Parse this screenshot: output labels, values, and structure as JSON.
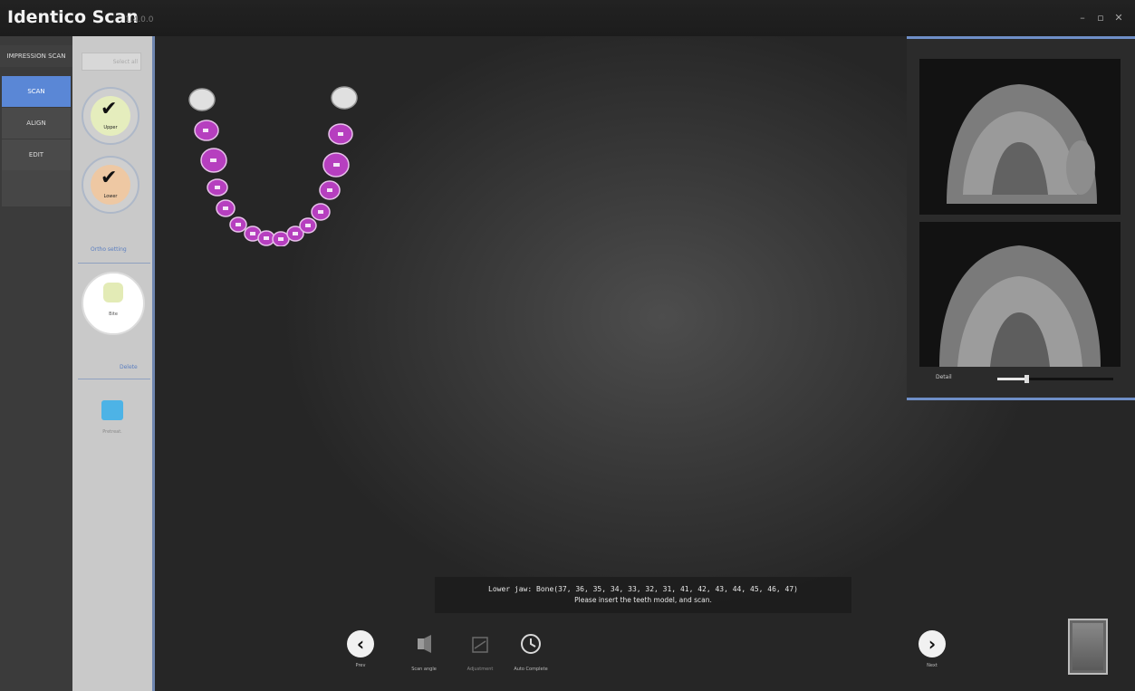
{
  "window": {
    "title": "Identico Scan",
    "version": "1.4.0.0",
    "controls": [
      "minimize-icon",
      "maximize-icon",
      "close-icon"
    ]
  },
  "nav": {
    "header": "IMPRESSION SCAN",
    "items": [
      {
        "label": "SCAN",
        "active": true
      },
      {
        "label": "ALIGN",
        "active": false
      },
      {
        "label": "EDIT",
        "active": false
      }
    ]
  },
  "tray": {
    "top_bar": "Select all",
    "stages": [
      {
        "label": "Upper",
        "complete": true
      },
      {
        "label": "Lower",
        "complete": true
      }
    ],
    "link_1": "Ortho setting",
    "current_stage": {
      "label": "Bite"
    },
    "link_2": "Delete",
    "extra_stage": {
      "label": "Pretreat."
    }
  },
  "tooth_map": {
    "upper_highlight": [
      "17",
      "27"
    ],
    "selected_teeth": [
      "16",
      "15",
      "14",
      "13",
      "12",
      "11",
      "21",
      "22",
      "23",
      "24",
      "25",
      "26",
      "27"
    ],
    "colors": {
      "selected": "#b63fbf",
      "unselected": "#d9d9d9"
    }
  },
  "preview": {
    "views": [
      "top-view",
      "bottom-view"
    ],
    "slider_label": "Detail",
    "slider_value": 0.25
  },
  "message": {
    "line1": "Lower jaw: Bone(37, 36, 35, 34, 33, 32, 31, 41, 42, 43, 44, 45, 46, 47)",
    "line2": "Please insert the teeth model, and scan."
  },
  "toolbar": {
    "prev": "Prev",
    "scan_angle": "Scan angle",
    "adjustment": "Adjustment",
    "auto_complete": "Auto Complete",
    "next": "Next"
  },
  "accent": "#5a87d6"
}
